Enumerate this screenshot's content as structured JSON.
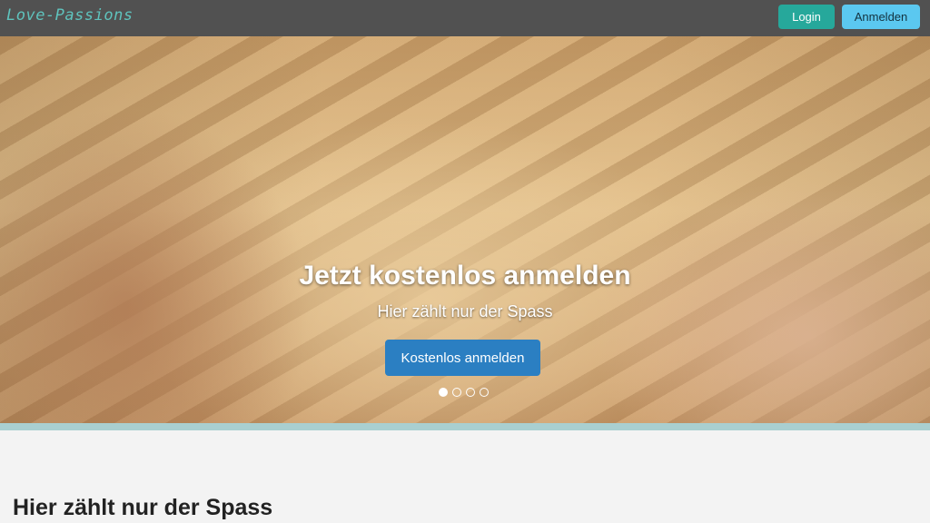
{
  "navbar": {
    "brand": "Love-Passions",
    "login_label": "Login",
    "register_label": "Anmelden"
  },
  "hero": {
    "title": "Jetzt kostenlos anmelden",
    "subtitle": "Hier zählt nur der Spass",
    "cta_label": "Kostenlos anmelden",
    "carousel": {
      "slide_count": 4,
      "active_index": 0
    }
  },
  "content": {
    "heading": "Hier zählt nur der Spass"
  },
  "colors": {
    "navbar_bg": "#515151",
    "brand": "#5fc3bd",
    "login_button": "#26a89b",
    "register_button": "#5bc8f0",
    "cta_button": "#2b7fc2",
    "hero_border": "#a9cfd0"
  }
}
